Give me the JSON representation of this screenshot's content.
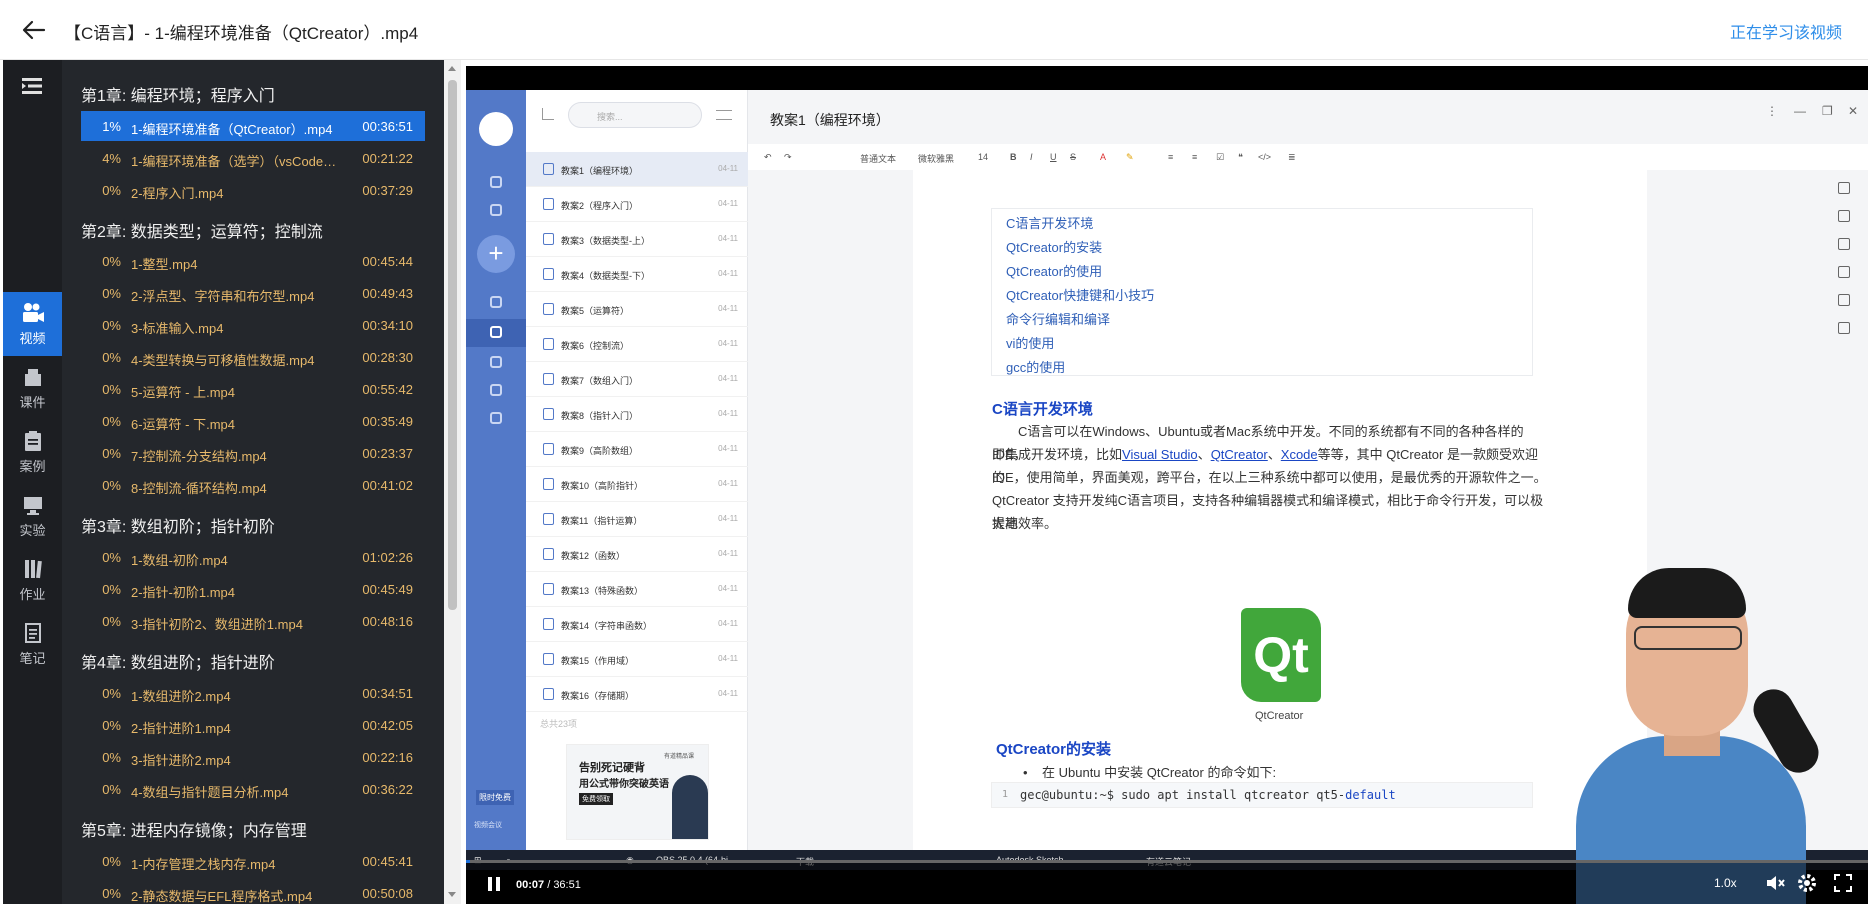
{
  "header": {
    "title": "【C语言】- 1-编程环境准备（QtCreator）.mp4",
    "study_link": "正在学习该视频"
  },
  "nav": [
    {
      "label": "视频",
      "icon": "video-camera-icon",
      "active": true
    },
    {
      "label": "课件",
      "icon": "courseware-icon"
    },
    {
      "label": "案例",
      "icon": "case-clipboard-icon"
    },
    {
      "label": "实验",
      "icon": "lab-monitor-icon"
    },
    {
      "label": "作业",
      "icon": "homework-books-icon"
    },
    {
      "label": "笔记",
      "icon": "notes-icon"
    }
  ],
  "chapters": [
    {
      "title": "第1章: 编程环境；程序入门",
      "lessons": [
        {
          "pct": "1%",
          "name": "1-编程环境准备（QtCreator）.mp4",
          "dur": "00:36:51",
          "active": true
        },
        {
          "pct": "4%",
          "name": "1-编程环境准备（选学）（vsCode）.mp4",
          "dur": "00:21:22"
        },
        {
          "pct": "0%",
          "name": "2-程序入门.mp4",
          "dur": "00:37:29"
        }
      ]
    },
    {
      "title": "第2章: 数据类型；运算符；控制流",
      "lessons": [
        {
          "pct": "0%",
          "name": "1-整型.mp4",
          "dur": "00:45:44"
        },
        {
          "pct": "0%",
          "name": "2-浮点型、字符串和布尔型.mp4",
          "dur": "00:49:43"
        },
        {
          "pct": "0%",
          "name": "3-标准输入.mp4",
          "dur": "00:34:10"
        },
        {
          "pct": "0%",
          "name": "4-类型转换与可移植性数据.mp4",
          "dur": "00:28:30"
        },
        {
          "pct": "0%",
          "name": "5-运算符 - 上.mp4",
          "dur": "00:55:42"
        },
        {
          "pct": "0%",
          "name": "6-运算符 - 下.mp4",
          "dur": "00:35:49"
        },
        {
          "pct": "0%",
          "name": "7-控制流-分支结构.mp4",
          "dur": "00:23:37"
        },
        {
          "pct": "0%",
          "name": "8-控制流-循环结构.mp4",
          "dur": "00:41:02"
        }
      ]
    },
    {
      "title": "第3章: 数组初阶；指针初阶",
      "lessons": [
        {
          "pct": "0%",
          "name": "1-数组-初阶.mp4",
          "dur": "01:02:26"
        },
        {
          "pct": "0%",
          "name": "2-指针-初阶1.mp4",
          "dur": "00:45:49"
        },
        {
          "pct": "0%",
          "name": "3-指针初阶2、数组进阶1.mp4",
          "dur": "00:48:16"
        }
      ]
    },
    {
      "title": "第4章: 数组进阶；指针进阶",
      "lessons": [
        {
          "pct": "0%",
          "name": "1-数组进阶2.mp4",
          "dur": "00:34:51"
        },
        {
          "pct": "0%",
          "name": "2-指针进阶1.mp4",
          "dur": "00:42:05"
        },
        {
          "pct": "0%",
          "name": "3-指针进阶2.mp4",
          "dur": "00:22:16"
        },
        {
          "pct": "0%",
          "name": "4-数组与指针题目分析.mp4",
          "dur": "00:36:22"
        }
      ]
    },
    {
      "title": "第5章: 进程内存镜像；内存管理",
      "lessons": [
        {
          "pct": "0%",
          "name": "1-内存管理之栈内存.mp4",
          "dur": "00:45:41"
        },
        {
          "pct": "0%",
          "name": "2-静态数据与EFL程序格式.mp4",
          "dur": "00:50:08"
        }
      ]
    }
  ],
  "video": {
    "search_placeholder": "搜索...",
    "doc_title": "教案1（编程环境）",
    "notes": [
      {
        "name": "教案1（编程环境）",
        "date": "04-11"
      },
      {
        "name": "教案2（程序入门）",
        "date": "04-11"
      },
      {
        "name": "教案3（数据类型-上）",
        "date": "04-11"
      },
      {
        "name": "教案4（数据类型-下）",
        "date": "04-11"
      },
      {
        "name": "教案5（运算符）",
        "date": "04-11"
      },
      {
        "name": "教案6（控制流）",
        "date": "04-11"
      },
      {
        "name": "教案7（数组入门）",
        "date": "04-11"
      },
      {
        "name": "教案8（指针入门）",
        "date": "04-11"
      },
      {
        "name": "教案9（高阶数组）",
        "date": "04-11"
      },
      {
        "name": "教案10（高阶指针）",
        "date": "04-11"
      },
      {
        "name": "教案11（指针运算）",
        "date": "04-11"
      },
      {
        "name": "教案12（函数）",
        "date": "04-11"
      },
      {
        "name": "教案13（特殊函数）",
        "date": "04-11"
      },
      {
        "name": "教案14（字符串函数）",
        "date": "04-11"
      },
      {
        "name": "教案15（作用域）",
        "date": "04-11"
      },
      {
        "name": "教案16（存储期）",
        "date": "04-11"
      }
    ],
    "note_count": "总共23项",
    "ad": {
      "line1": "告别死记硬背",
      "line2": "用公式带你突破英语",
      "tag": "免费领取",
      "brand": "有道精品课"
    },
    "promo_tag": "限时免费",
    "promo_sub": "视频会议",
    "toolbar": [
      "普通文本",
      "微软雅黑",
      "14"
    ],
    "toc": [
      "C语言开发环境",
      "QtCreator的安装",
      "QtCreator的使用",
      "QtCreator快捷键和小技巧",
      "命令行编辑和编译",
      "vi的使用",
      "gcc的使用"
    ],
    "h_env": "C语言开发环境",
    "para_env_1": "C语言可以在Windows、Ubuntu或者Mac系统中开发。不同的系统都有不同的各种各样的IDE，",
    "para_env_2a": "即集成开发环境，比如",
    "link_vs": "Visual Studio",
    "sep1": "、",
    "link_qt": "QtCreator",
    "sep2": "、",
    "link_xcode": "Xcode",
    "para_env_2b": "等等，其中 QtCreator 是一款颇受欢迎的",
    "para_env_3": "IDE，使用简单，界面美观，跨平台，在以上三种系统中都可以使用，是最优秀的开源软件之一。",
    "para_env_4": "QtCreator 支持开发纯C语言项目，支持各种编辑器模式和编译模式，相比于命令行开发，可以极大地",
    "para_env_5": "提高效率。",
    "qt_logo": "Qt",
    "qt_caption": "QtCreator",
    "h_install": "QtCreator的安装",
    "bullet_install": "在 Ubuntu 中安装 QtCreator 的命令如下:",
    "code_line": "1",
    "code_text": "gec@ubuntu:~$ sudo apt install qtcreator qt5-",
    "code_kw": "default",
    "taskbar": [
      "OBS 25.0.4 (64-bi...",
      "下载",
      "Autodesk Sketch...",
      "有道云笔记"
    ]
  },
  "player": {
    "current": "00:07",
    "total": "/ 36:51",
    "speed": "1.0x",
    "progress_fraction": 0.003
  }
}
